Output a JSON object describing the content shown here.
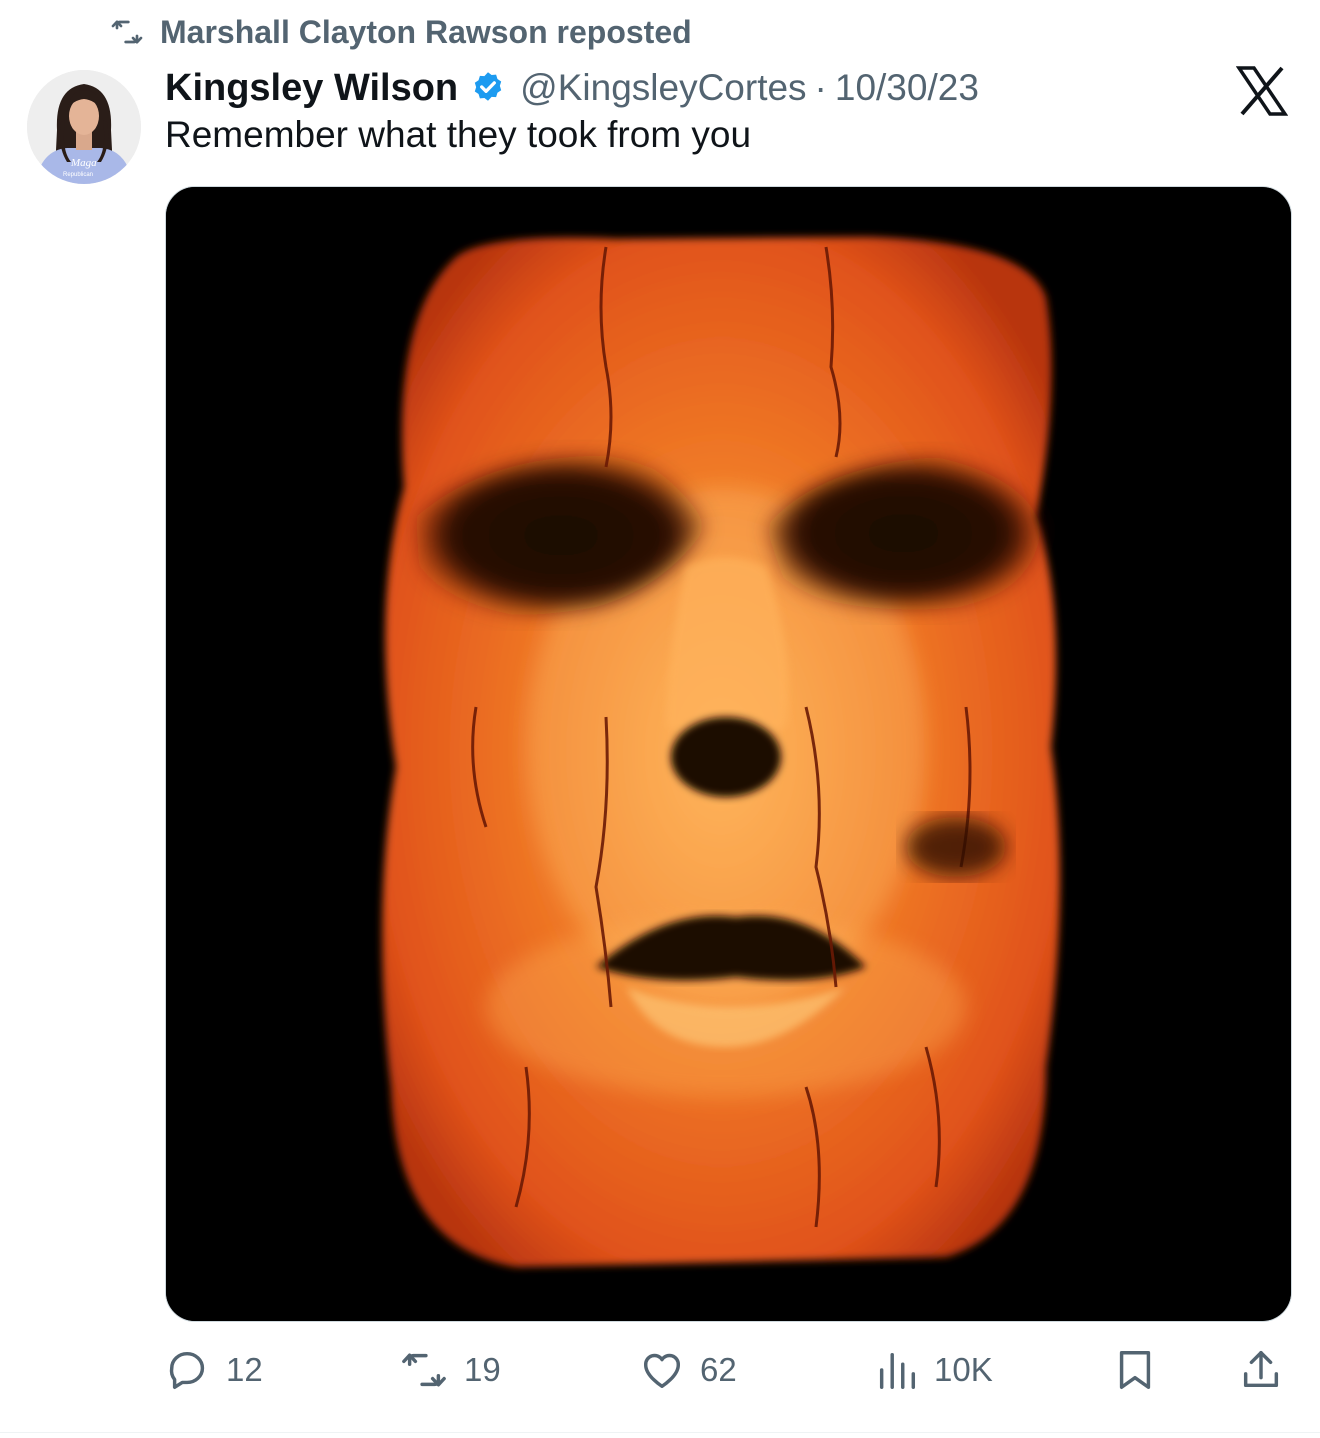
{
  "repost": {
    "label": "Marshall Clayton Rawson reposted",
    "icon": "repost-icon"
  },
  "author": {
    "display_name": "Kingsley Wilson",
    "verified": true,
    "handle": "@KingsleyCortes",
    "separator": "·",
    "date": "10/30/23",
    "avatar_shirt_text_1": "Maga",
    "avatar_shirt_text_2": "Republican"
  },
  "tweet": {
    "text": "Remember what they took from you"
  },
  "media": {
    "description_icon": "image"
  },
  "actions": {
    "replies": "12",
    "reposts": "19",
    "likes": "62",
    "views": "10K"
  },
  "colors": {
    "text_primary": "#0f1419",
    "text_secondary": "#536471",
    "verified_blue": "#1d9bf0",
    "media_background": "#000000",
    "toast_orange": "#e8571a"
  }
}
